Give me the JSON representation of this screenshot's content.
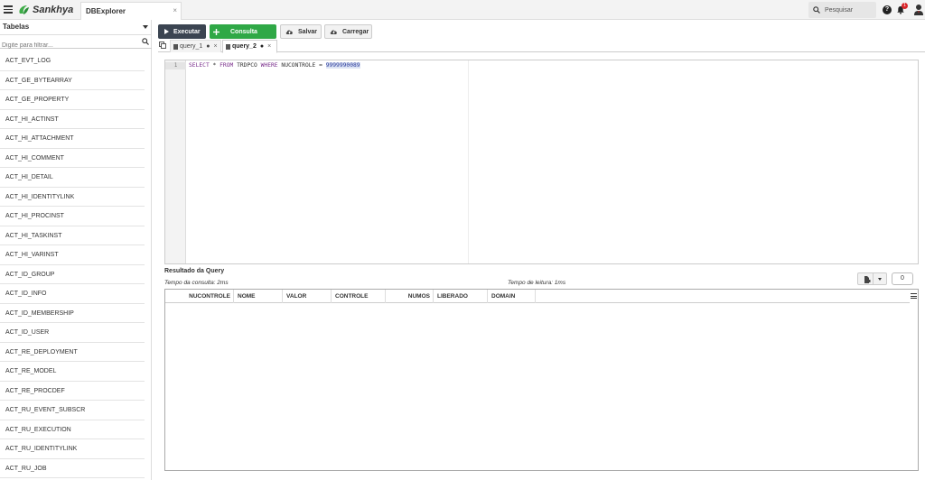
{
  "topbar": {
    "brand": "Sankhya",
    "app_tab": "DBExplorer",
    "app_tab_close": "×",
    "search_label": "Pesquisar",
    "help": "?",
    "notification_count": "1"
  },
  "sidebar": {
    "selector": "Tabelas",
    "filter_placeholder": "Digite para filtrar...",
    "tables": [
      "ACT_EVT_LOG",
      "ACT_GE_BYTEARRAY",
      "ACT_GE_PROPERTY",
      "ACT_HI_ACTINST",
      "ACT_HI_ATTACHMENT",
      "ACT_HI_COMMENT",
      "ACT_HI_DETAIL",
      "ACT_HI_IDENTITYLINK",
      "ACT_HI_PROCINST",
      "ACT_HI_TASKINST",
      "ACT_HI_VARINST",
      "ACT_ID_GROUP",
      "ACT_ID_INFO",
      "ACT_ID_MEMBERSHIP",
      "ACT_ID_USER",
      "ACT_RE_DEPLOYMENT",
      "ACT_RE_MODEL",
      "ACT_RE_PROCDEF",
      "ACT_RU_EVENT_SUBSCR",
      "ACT_RU_EXECUTION",
      "ACT_RU_IDENTITYLINK",
      "ACT_RU_JOB"
    ]
  },
  "toolbar": {
    "execute_label": "Executar",
    "consulta_label": "Consulta",
    "save_label": "Salvar",
    "load_label": "Carregar"
  },
  "query_tabs": [
    {
      "label": "query_1",
      "modified": "●",
      "close": "×"
    },
    {
      "label": "query_2",
      "modified": "●",
      "close": "×"
    }
  ],
  "editor": {
    "line_number": "1",
    "sql": {
      "kw_select": "SELECT",
      "star": " * ",
      "kw_from": "FROM",
      "table": " TRDPCO ",
      "kw_where": "WHERE",
      "condition": " NUCONTROLE = ",
      "value": "9999990089"
    }
  },
  "result": {
    "title": "Resultado da Query",
    "query_time": "Tempo da consulta: 2ms",
    "read_time": "Tempo de leitura: 1ms",
    "row_count": "0",
    "columns": [
      "NUCONTROLE",
      "NOME",
      "VALOR",
      "CONTROLE",
      "NUMOS",
      "LIBERADO",
      "DOMAIN"
    ],
    "rows": []
  },
  "colors": {
    "execute_bg": "#3b4451",
    "consulta_bg": "#2fa846",
    "brand_green": "#3fae49",
    "badge_red": "#d9262a",
    "sql_keyword": "#7a2f8c",
    "sql_number": "#2b3b9c"
  }
}
